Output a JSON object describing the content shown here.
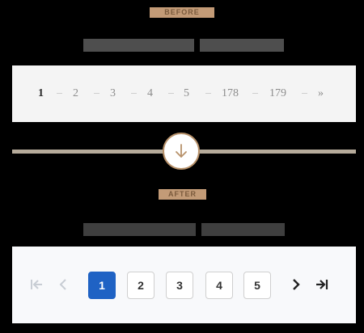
{
  "labels": {
    "before": "BEFORE",
    "after": "AFTER"
  },
  "before_pagination": {
    "items": [
      "1",
      "2",
      "3",
      "4",
      "5",
      "178",
      "179",
      "»"
    ],
    "active": "1"
  },
  "after_pagination": {
    "pages": [
      "1",
      "2",
      "3",
      "4",
      "5"
    ],
    "active": "1",
    "first_icon": "first-page-icon",
    "prev_icon": "chevron-left-icon",
    "next_icon": "chevron-right-icon",
    "last_icon": "last-page-icon"
  },
  "colors": {
    "accent": "#1f62c4",
    "tag": "#c39b77",
    "circle_border": "#b7916a"
  }
}
